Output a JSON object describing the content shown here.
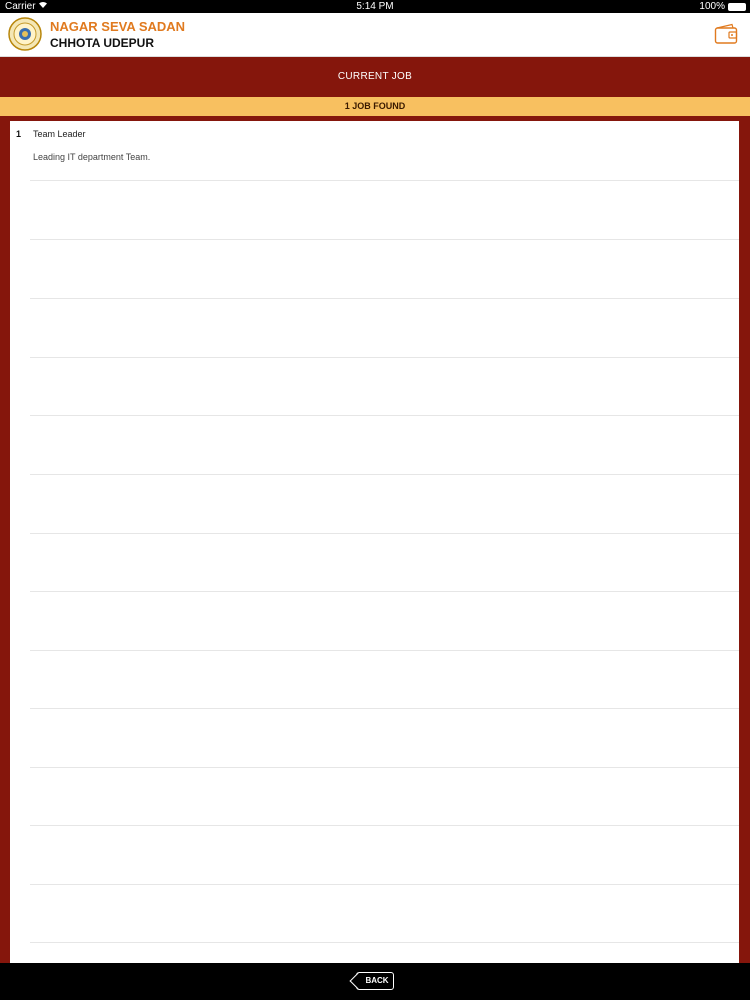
{
  "status_bar": {
    "carrier": "Carrier",
    "time": "5:14 PM",
    "battery": "100%"
  },
  "header": {
    "title_line1": "NAGAR SEVA SADAN",
    "title_line2": "CHHOTA UDEPUR",
    "logo_icon": "municipal-seal-icon",
    "wallet_icon": "wallet-icon"
  },
  "page": {
    "section_title": "CURRENT JOB",
    "found_text": "1 JOB FOUND"
  },
  "jobs": [
    {
      "number": "1",
      "title": "Team Leader",
      "description": "Leading IT department Team."
    }
  ],
  "footer": {
    "back_label": "BACK"
  },
  "colors": {
    "maroon": "#85160c",
    "found_bar": "#f8c060",
    "title_orange": "#e07a1f"
  }
}
